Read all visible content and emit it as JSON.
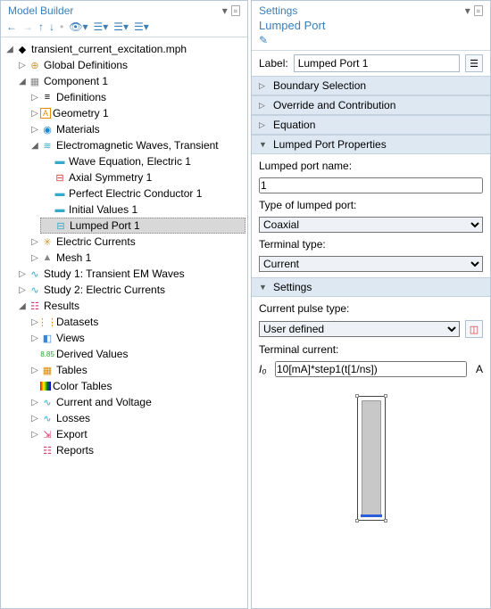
{
  "left": {
    "title": "Model Builder",
    "tree": {
      "root": "transient_current_excitation.mph",
      "globaldefs": "Global Definitions",
      "component1": "Component 1",
      "definitions": "Definitions",
      "geometry1": "Geometry 1",
      "materials": "Materials",
      "emwaves": "Electromagnetic Waves, Transient",
      "waveeq": "Wave Equation, Electric 1",
      "axial": "Axial Symmetry 1",
      "pec": "Perfect Electric Conductor 1",
      "initial": "Initial Values 1",
      "lumped": "Lumped Port 1",
      "electric_currents": "Electric Currents",
      "mesh1": "Mesh 1",
      "study1": "Study 1: Transient EM Waves",
      "study2": "Study 2: Electric Currents",
      "results": "Results",
      "datasets": "Datasets",
      "views": "Views",
      "derived": "Derived Values",
      "tables": "Tables",
      "colortables": "Color Tables",
      "currentvoltage": "Current and Voltage",
      "losses": "Losses",
      "export": "Export",
      "reports": "Reports"
    }
  },
  "right": {
    "title": "Settings",
    "subtitle": "Lumped Port",
    "label_lbl": "Label:",
    "label_val": "Lumped Port 1",
    "sections": {
      "boundary": "Boundary Selection",
      "override": "Override and Contribution",
      "equation": "Equation",
      "props": "Lumped Port Properties",
      "settingsx": "Settings"
    },
    "port_name_lbl": "Lumped port name:",
    "port_name_val": "1",
    "port_type_lbl": "Type of lumped port:",
    "port_type_val": "Coaxial",
    "term_type_lbl": "Terminal type:",
    "term_type_val": "Current",
    "pulse_type_lbl": "Current pulse type:",
    "pulse_type_val": "User defined",
    "term_current_lbl": "Terminal current:",
    "term_current_sym": "I₀",
    "term_current_val": "10[mA]*step1(t[1/ns])",
    "term_current_unit": "A"
  }
}
